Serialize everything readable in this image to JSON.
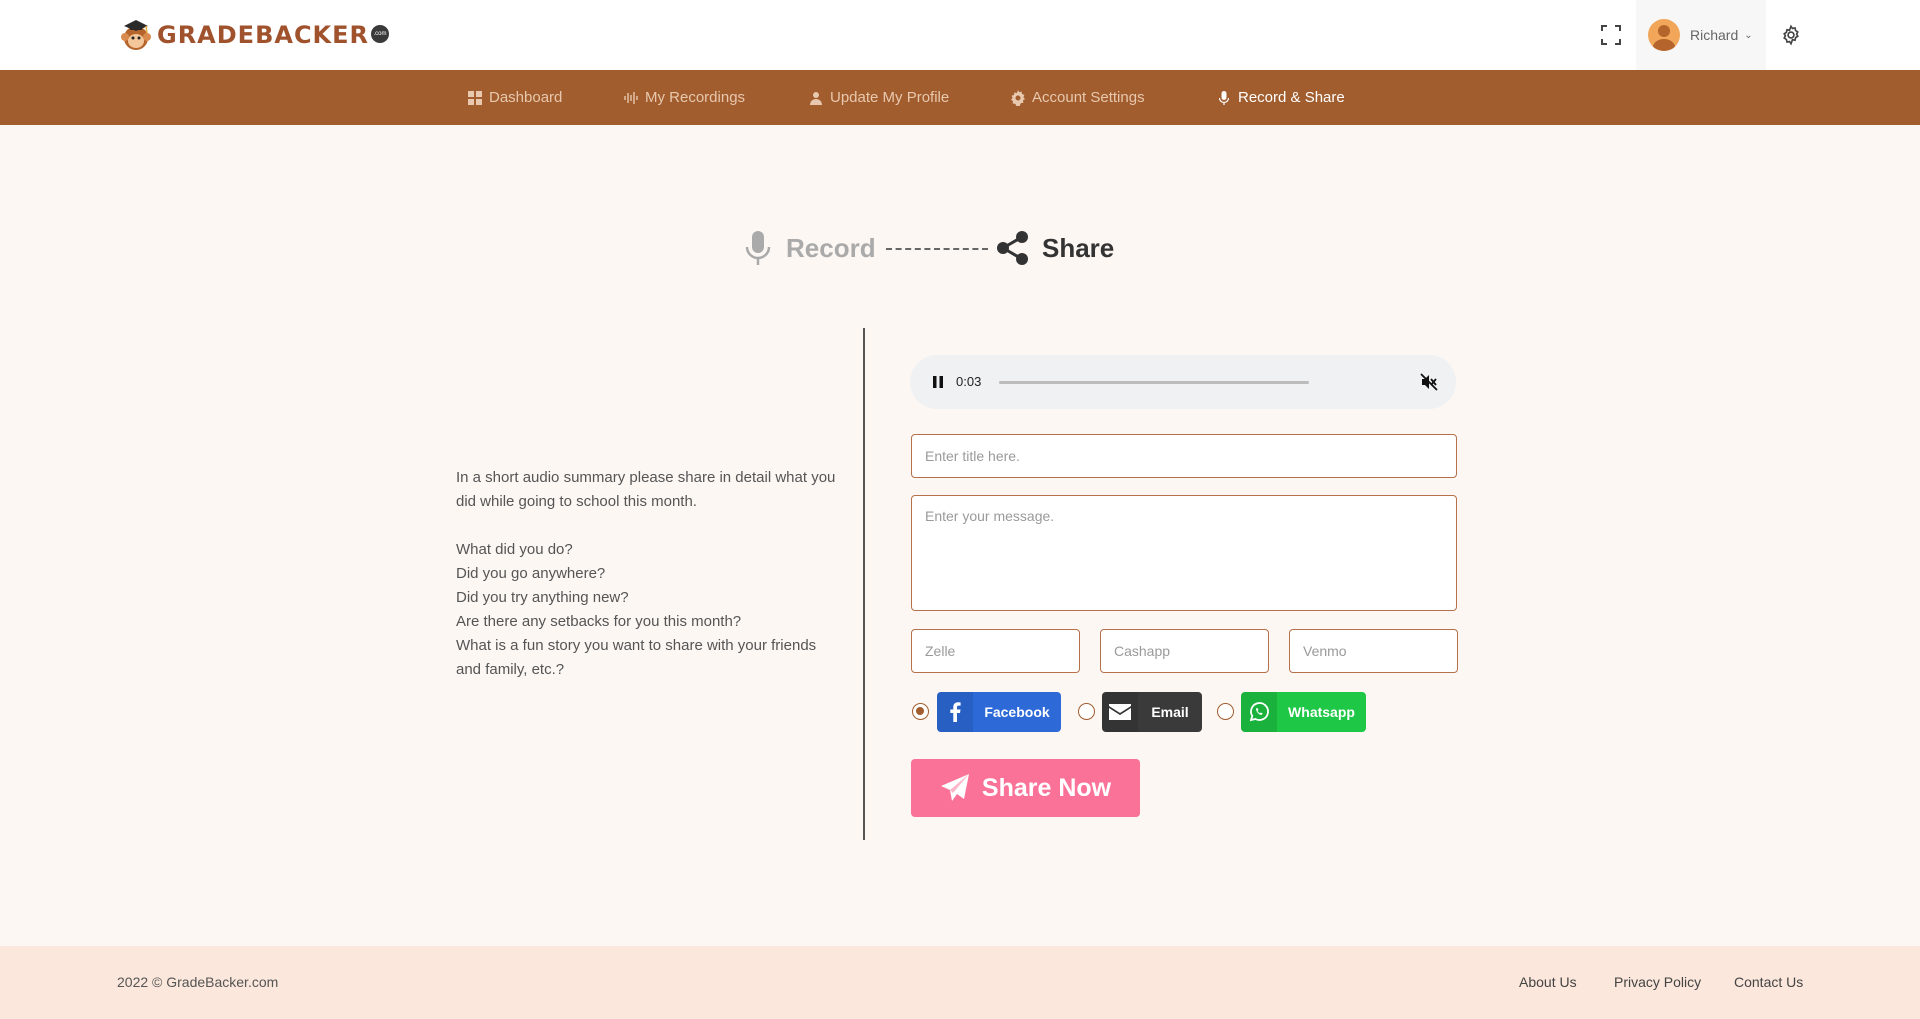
{
  "header": {
    "logo_text": "GRADEBACKER",
    "logo_suffix": ".com",
    "user_name": "Richard"
  },
  "nav": {
    "items": [
      {
        "label": "Dashboard",
        "icon": "dashboard-icon"
      },
      {
        "label": "My Recordings",
        "icon": "waveform-icon"
      },
      {
        "label": "Update My Profile",
        "icon": "user-icon"
      },
      {
        "label": "Account Settings",
        "icon": "gear-icon"
      },
      {
        "label": "Record & Share",
        "icon": "microphone-icon",
        "active": true
      }
    ]
  },
  "stepper": {
    "record_label": "Record",
    "share_label": "Share"
  },
  "prompt": {
    "intro": "In a short audio summary please share in detail what you did while going to school this month.",
    "questions": [
      "What did you do?",
      "Did you go anywhere?",
      "Did you try anything new?",
      "Are there any setbacks for you this month?",
      "What is a fun story you want to share with your friends and family, etc.?"
    ]
  },
  "player": {
    "time": "0:03",
    "progress": 0.0
  },
  "form": {
    "title_placeholder": "Enter title here.",
    "message_placeholder": "Enter your message.",
    "zelle_placeholder": "Zelle",
    "cashapp_placeholder": "Cashapp",
    "venmo_placeholder": "Venmo"
  },
  "share_options": [
    {
      "label": "Facebook",
      "color": "#2d6ad8",
      "icon": "facebook-icon",
      "selected": true
    },
    {
      "label": "Email",
      "color": "#3a3a3a",
      "icon": "envelope-icon",
      "selected": false
    },
    {
      "label": "Whatsapp",
      "color": "#1ec745",
      "icon": "whatsapp-icon",
      "selected": false
    }
  ],
  "share_button": "Share Now",
  "footer": {
    "copyright": "2022 © GradeBacker.com",
    "links": [
      "About Us",
      "Privacy Policy",
      "Contact Us"
    ]
  },
  "colors": {
    "brand": "#a15d2e",
    "share_now": "#fb7299",
    "background": "#fdf7f3",
    "footer": "#fbe7db"
  }
}
